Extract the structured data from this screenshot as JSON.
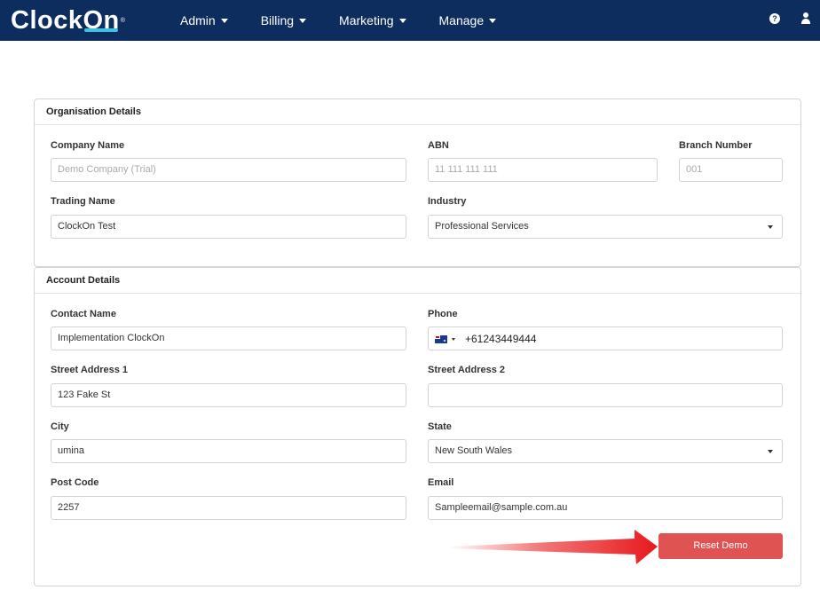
{
  "brand": {
    "logo_text": "Clock",
    "logo_accent": "On",
    "logo_reg": "®"
  },
  "nav": {
    "items": [
      {
        "label": "Admin"
      },
      {
        "label": "Billing"
      },
      {
        "label": "Marketing"
      },
      {
        "label": "Manage"
      }
    ],
    "help_glyph": "?"
  },
  "organisation": {
    "title": "Organisation Details",
    "company_name": {
      "label": "Company Name",
      "placeholder": "Demo Company (Trial)"
    },
    "abn": {
      "label": "ABN",
      "placeholder": "11 111 111 111"
    },
    "branch_number": {
      "label": "Branch Number",
      "placeholder": "001"
    },
    "trading_name": {
      "label": "Trading Name",
      "value": "ClockOn Test"
    },
    "industry": {
      "label": "Industry",
      "value": "Professional Services"
    }
  },
  "account": {
    "title": "Account Details",
    "contact_name": {
      "label": "Contact Name",
      "value": "Implementation ClockOn"
    },
    "phone": {
      "label": "Phone",
      "value": "+61243449444"
    },
    "street1": {
      "label": "Street Address 1",
      "value": "123 Fake St"
    },
    "street2": {
      "label": "Street Address 2",
      "value": ""
    },
    "city": {
      "label": "City",
      "value": "umina"
    },
    "state": {
      "label": "State",
      "value": "New South Wales"
    },
    "post_code": {
      "label": "Post Code",
      "value": "2257"
    },
    "email": {
      "label": "Email",
      "value": "Sampleemail@sample.com.au"
    }
  },
  "actions": {
    "reset_label": "Reset Demo"
  },
  "colors": {
    "navbar": "#0c2d5e",
    "reset_button": "#e05353",
    "arrow": "#e8191b",
    "logo_accent": "#3fc1e0"
  }
}
